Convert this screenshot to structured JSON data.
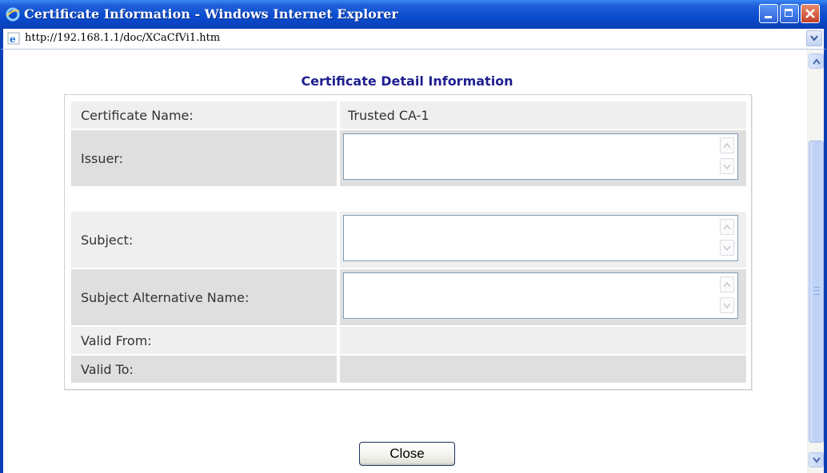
{
  "window": {
    "title": "Certificate Information - Windows Internet Explorer",
    "address": "http://192.168.1.1/doc/XCaCfVi1.htm"
  },
  "page": {
    "title": "Certificate Detail Information"
  },
  "fields": {
    "certificate_name_label": "Certificate Name:",
    "certificate_name_value": "Trusted CA-1",
    "issuer_label": "Issuer:",
    "issuer_value": "",
    "subject_label": "Subject:",
    "subject_value": "",
    "san_label": "Subject Alternative Name:",
    "san_value": "",
    "valid_from_label": "Valid From:",
    "valid_from_value": "",
    "valid_to_label": "Valid To:",
    "valid_to_value": ""
  },
  "buttons": {
    "close_label": "Close"
  },
  "colors": {
    "title_text": "#1f1f8f",
    "row_light": "#efefef",
    "row_dark": "#dfdfdf",
    "titlebar": "#0a4ccf"
  },
  "icons": {
    "window_icon": "ie-icon",
    "address_icon": "ie-page-icon"
  }
}
